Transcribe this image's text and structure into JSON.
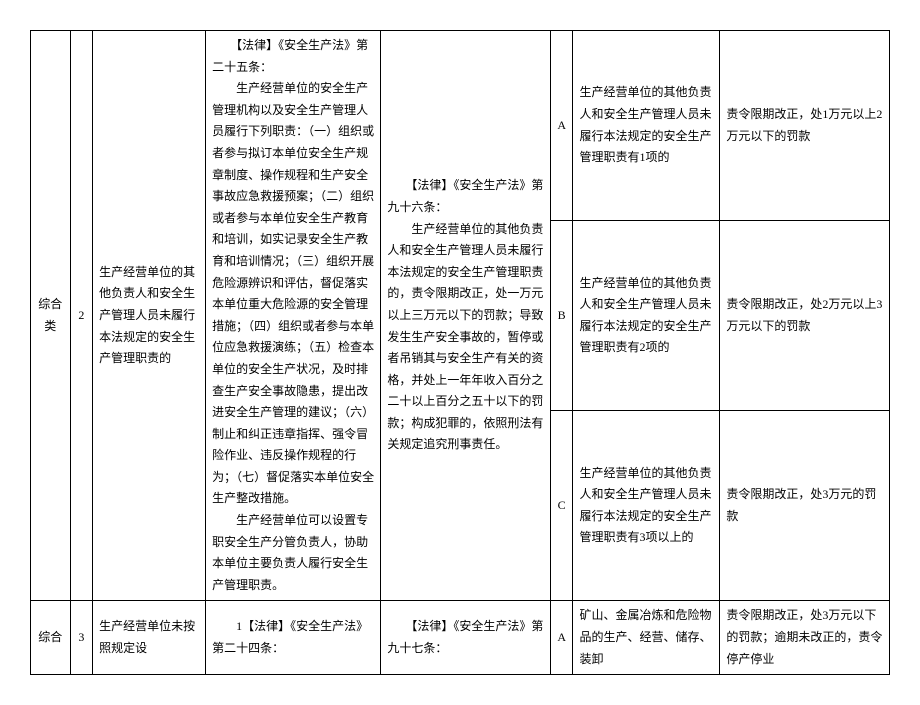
{
  "rows": {
    "row2": {
      "category": "综合类",
      "num": "2",
      "desc": "生产经营单位的其他负责人和安全生产管理人员未履行本法规定的安全生产管理职责的",
      "law1": "　　【法律】《安全生产法》第二十五条：\n　　生产经营单位的安全生产管理机构以及安全生产管理人员履行下列职责：（一）组织或者参与拟订本单位安全生产规章制度、操作规程和生产安全事故应急救援预案；（二）组织或者参与本单位安全生产教育和培训，如实记录安全生产教育和培训情况；（三）组织开展危险源辨识和评估，督促落实本单位重大危险源的安全管理措施；（四）组织或者参与本单位应急救援演练；（五）检查本单位的安全生产状况，及时排查生产安全事故隐患，提出改进安全生产管理的建议；（六）制止和纠正违章指挥、强令冒险作业、违反操作规程的行为；（七）督促落实本单位安全生产整改措施。\n　　生产经营单位可以设置专职安全生产分管负责人，协助本单位主要负责人履行安全生产管理职责。",
      "law2": "　　【法律】《安全生产法》第九十六条：\n　　生产经营单位的其他负责人和安全生产管理人员未履行本法规定的安全生产管理职责的，责令限期改正，处一万元以上三万元以下的罚款；导致发生生产安全事故的，暂停或者吊销其与安全生产有关的资格，并处上一年年收入百分之二十以上百分之五十以下的罚款；构成犯罪的，依照刑法有关规定追究刑事责任。",
      "sub": {
        "a": {
          "grade": "A",
          "cond": "生产经营单位的其他负责人和安全生产管理人员未履行本法规定的安全生产管理职责有1项的",
          "penalty": "责令限期改正，处1万元以上2万元以下的罚款"
        },
        "b": {
          "grade": "B",
          "cond": "生产经营单位的其他负责人和安全生产管理人员未履行本法规定的安全生产管理职责有2项的",
          "penalty": "责令限期改正，处2万元以上3万元以下的罚款"
        },
        "c": {
          "grade": "C",
          "cond": "生产经营单位的其他负责人和安全生产管理人员未履行本法规定的安全生产管理职责有3项以上的",
          "penalty": "责令限期改正，处3万元的罚款"
        }
      }
    },
    "row3": {
      "category": "综合",
      "num": "3",
      "desc": "生产经营单位未按照规定设",
      "law1": "　　1【法律】《安全生产法》第二十四条：",
      "law2": "　　【法律】《安全生产法》第九十七条：",
      "grade": "A",
      "cond": "矿山、金属冶炼和危险物品的生产、经营、储存、装卸",
      "penalty": "责令限期改正，处3万元以下的罚款；逾期未改正的，责令停产停业"
    }
  }
}
